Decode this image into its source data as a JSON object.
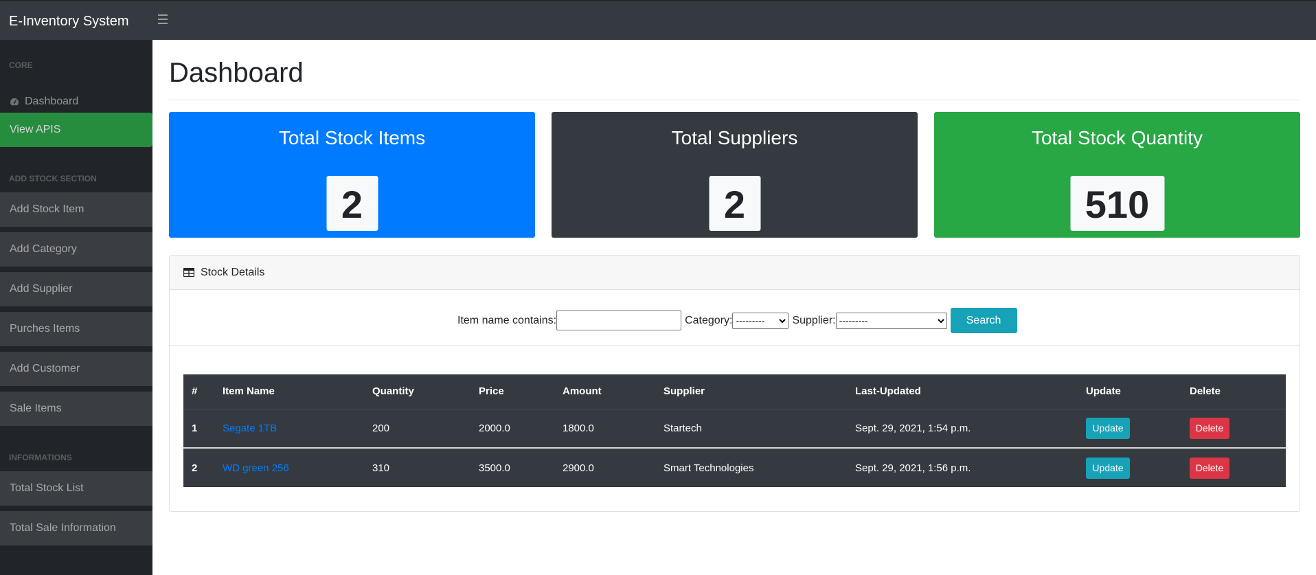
{
  "navbar": {
    "brand": "E-Inventory System",
    "toggle_icon": "hamburger-icon"
  },
  "sidebar": {
    "sections": [
      {
        "heading": "CORE"
      },
      {
        "heading": "ADD STOCK SECTION"
      },
      {
        "heading": "INFORMATIONS"
      }
    ],
    "dashboard_label": "Dashboard",
    "dashboard_icon": "tachometer-icon",
    "view_apis_label": "View APIS",
    "stock_items": [
      {
        "label": "Add Stock Item"
      },
      {
        "label": "Add Category"
      },
      {
        "label": "Add Supplier"
      },
      {
        "label": "Purches Items"
      },
      {
        "label": "Add Customer"
      },
      {
        "label": "Sale Items"
      }
    ],
    "info_items": [
      {
        "label": "Total Stock List"
      },
      {
        "label": "Total Sale Information"
      }
    ]
  },
  "main": {
    "title": "Dashboard",
    "stats": [
      {
        "label": "Total Stock Items",
        "value": "2",
        "color": "#007bff"
      },
      {
        "label": "Total Suppliers",
        "value": "2",
        "color": "#343a40"
      },
      {
        "label": "Total Stock Quantity",
        "value": "510",
        "color": "#28a745"
      }
    ],
    "details": {
      "header": "Stock Details",
      "header_icon": "table-icon",
      "filter": {
        "item_label": "Item name contains:",
        "item_value": "",
        "category_label": "Category:",
        "category_selected": "---------",
        "supplier_label": "Supplier:",
        "supplier_selected": "---------",
        "search_button": "Search"
      },
      "columns": [
        "#",
        "Item Name",
        "Quantity",
        "Price",
        "Amount",
        "Supplier",
        "Last-Updated",
        "Update",
        "Delete"
      ],
      "rows": [
        {
          "num": "1",
          "name": "Segate 1TB",
          "quantity": "200",
          "price": "2000.0",
          "amount": "1800.0",
          "supplier": "Startech",
          "updated": "Sept. 29, 2021, 1:54 p.m.",
          "update_btn": "Update",
          "delete_btn": "Delete"
        },
        {
          "num": "2",
          "name": "WD green 256",
          "quantity": "310",
          "price": "3500.0",
          "amount": "2900.0",
          "supplier": "Smart Technologies",
          "updated": "Sept. 29, 2021, 1:56 p.m.",
          "update_btn": "Update",
          "delete_btn": "Delete"
        }
      ]
    }
  },
  "colors": {
    "navbar": "#343a40",
    "sidebar": "#212529",
    "active": "#28a745",
    "primary": "#007bff",
    "info": "#17a2b8",
    "danger": "#dc3545"
  }
}
